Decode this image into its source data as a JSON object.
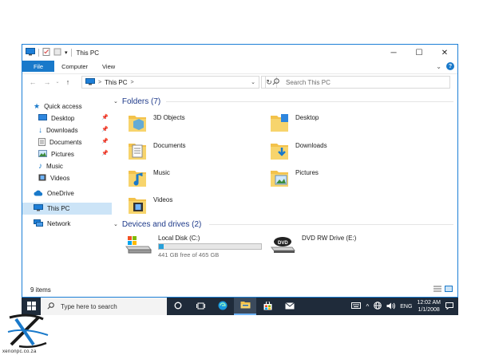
{
  "window": {
    "title": "This PC",
    "controls": {
      "minimize": "─",
      "maximize": "☐",
      "close": "✕"
    }
  },
  "ribbon": {
    "tabs": [
      "File",
      "Computer",
      "View"
    ]
  },
  "address": {
    "path": "This PC",
    "separator": ">",
    "search_placeholder": "Search This PC"
  },
  "sidebar": {
    "quick_access": "Quick access",
    "items": [
      {
        "label": "Desktop",
        "pinned": true
      },
      {
        "label": "Downloads",
        "pinned": true
      },
      {
        "label": "Documents",
        "pinned": true
      },
      {
        "label": "Pictures",
        "pinned": true
      },
      {
        "label": "Music",
        "pinned": false
      },
      {
        "label": "Videos",
        "pinned": false
      }
    ],
    "onedrive": "OneDrive",
    "this_pc": "This PC",
    "network": "Network"
  },
  "content": {
    "folders_header": "Folders (7)",
    "folders": [
      "3D Objects",
      "Desktop",
      "Documents",
      "Downloads",
      "Music",
      "Pictures",
      "Videos"
    ],
    "drives_header": "Devices and drives (2)",
    "drives": [
      {
        "name": "Local Disk (C:)",
        "free_text": "441 GB free of 465 GB",
        "used_fraction": 0.05
      },
      {
        "name": "DVD RW Drive (E:)",
        "badge": "DVD"
      }
    ]
  },
  "status": {
    "items": "9 items"
  },
  "taskbar": {
    "search_placeholder": "Type here to search",
    "language": "ENG",
    "time": "12:02 AM",
    "date": "1/1/2008"
  },
  "logo": {
    "text": "xenonpc.co.za"
  },
  "colors": {
    "accent": "#1979ca",
    "folder": "#f3c24b",
    "taskbar": "#1f2b3a",
    "selected": "#cce4f7"
  }
}
